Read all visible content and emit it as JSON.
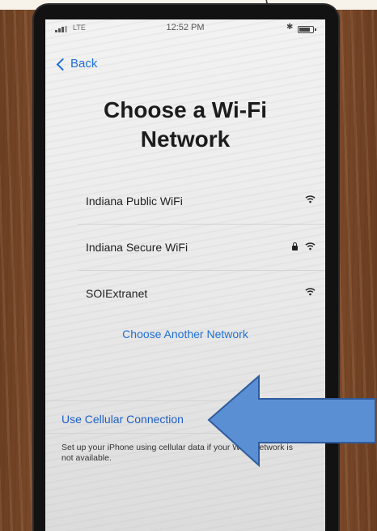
{
  "status_bar": {
    "carrier": "LTE",
    "time": "12:52 PM"
  },
  "nav": {
    "back_label": "Back"
  },
  "title": {
    "line1": "Choose a Wi-Fi",
    "line2": "Network"
  },
  "networks": [
    {
      "name": "Indiana Public WiFi",
      "secured": false,
      "icon": "wifi-icon"
    },
    {
      "name": "Indiana Secure WiFi",
      "secured": true,
      "icon": "wifi-icon"
    },
    {
      "name": "SOIExtranet",
      "secured": false,
      "icon": "wifi-icon"
    }
  ],
  "choose_another_label": "Choose Another Network",
  "cellular": {
    "link_label": "Use Cellular Connection",
    "note": "Set up your iPhone using cellular data if your Wi-Fi network is not available."
  },
  "colors": {
    "link": "#1f6fd6",
    "arrow": "#5b8fd4"
  }
}
